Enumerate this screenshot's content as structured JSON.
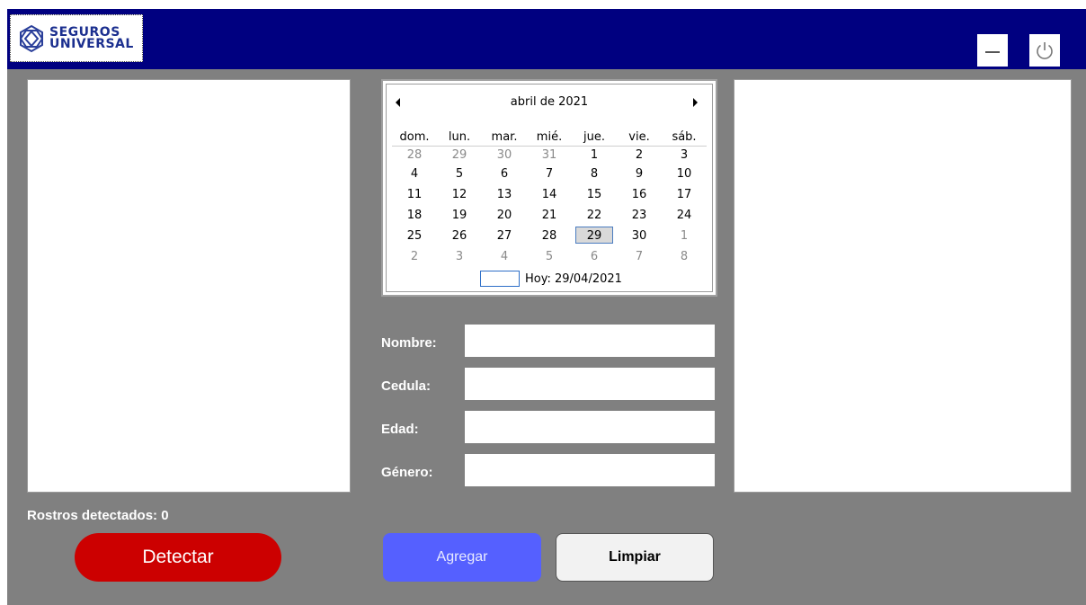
{
  "header": {
    "logo_line1": "SEGUROS",
    "logo_line2": "UNIVERSAL",
    "minimize_icon": "minimize-icon",
    "power_icon": "power-icon"
  },
  "calendar": {
    "month_title": "abril de 2021",
    "weekdays": [
      "dom.",
      "lun.",
      "mar.",
      "mié.",
      "jue.",
      "vie.",
      "sáb."
    ],
    "weeks": [
      [
        "28",
        "29",
        "30",
        "31",
        "1",
        "2",
        "3"
      ],
      [
        "4",
        "5",
        "6",
        "7",
        "8",
        "9",
        "10"
      ],
      [
        "11",
        "12",
        "13",
        "14",
        "15",
        "16",
        "17"
      ],
      [
        "18",
        "19",
        "20",
        "21",
        "22",
        "23",
        "24"
      ],
      [
        "25",
        "26",
        "27",
        "28",
        "29",
        "30",
        "1"
      ],
      [
        "2",
        "3",
        "4",
        "5",
        "6",
        "7",
        "8"
      ]
    ],
    "selected_day": "29",
    "today_label": "Hoy: 29/04/2021"
  },
  "form": {
    "nombre_label": "Nombre:",
    "cedula_label": "Cedula:",
    "edad_label": "Edad:",
    "genero_label": "Género:",
    "nombre_value": "",
    "cedula_value": "",
    "edad_value": "",
    "genero_value": ""
  },
  "status": {
    "rostros_label": "Rostros detectados:",
    "rostros_count": "0"
  },
  "buttons": {
    "detectar": "Detectar",
    "agregar": "Agregar",
    "limpiar": "Limpiar"
  },
  "colors": {
    "titlebar": "#000080",
    "background": "#808080",
    "detectar": "#cc0000",
    "agregar": "#5560ff"
  }
}
